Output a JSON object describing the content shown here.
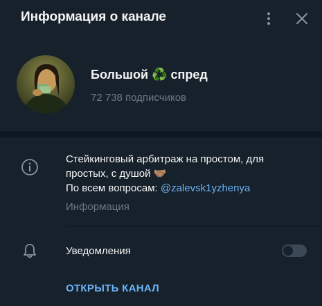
{
  "header": {
    "title": "Информация о канале"
  },
  "channel": {
    "name_prefix": "Большой",
    "name_emoji": "♻️",
    "name_suffix": "спред",
    "subscribers": "72 738 подписчиков"
  },
  "info": {
    "description_line1": "Стейкинговый арбитраж на простом, для простых, с душой 🤝🏽",
    "description_line2_prefix": "По всем вопросам: ",
    "description_link": "@zalevsk1yzhenya",
    "label": "Информация"
  },
  "notifications": {
    "label": "Уведомления",
    "enabled": false
  },
  "actions": {
    "open_channel": "ОТКРЫТЬ КАНАЛ"
  },
  "colors": {
    "background": "#17212b",
    "separator": "#0e1621",
    "accent": "#6ab3f3",
    "muted": "#6d7883",
    "text": "#f5f5f5"
  },
  "icons": {
    "more": "more-vertical-icon",
    "close": "close-icon",
    "info": "info-icon",
    "notifications": "bell-icon"
  }
}
